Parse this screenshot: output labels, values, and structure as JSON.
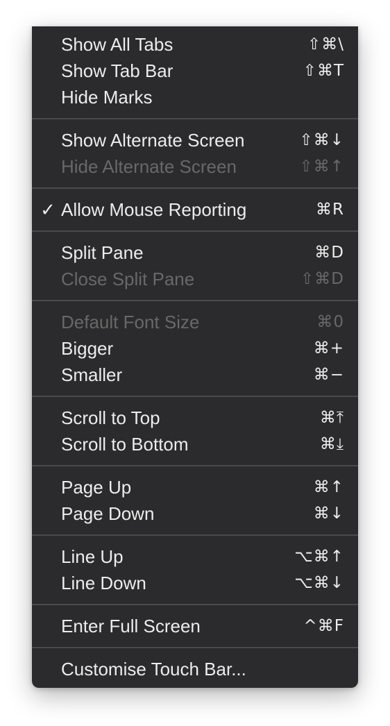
{
  "menu": {
    "groups": [
      [
        {
          "label": "Show All Tabs",
          "shortcut": "⇧⌘\\",
          "enabled": true,
          "checked": false
        },
        {
          "label": "Show Tab Bar",
          "shortcut": "⇧⌘T",
          "enabled": true,
          "checked": false
        },
        {
          "label": "Hide Marks",
          "shortcut": "",
          "enabled": true,
          "checked": false
        }
      ],
      [
        {
          "label": "Show Alternate Screen",
          "shortcut": "⇧⌘↓",
          "enabled": true,
          "checked": false
        },
        {
          "label": "Hide Alternate Screen",
          "shortcut": "⇧⌘↑",
          "enabled": false,
          "checked": false
        }
      ],
      [
        {
          "label": "Allow Mouse Reporting",
          "shortcut": "⌘R",
          "enabled": true,
          "checked": true
        }
      ],
      [
        {
          "label": "Split Pane",
          "shortcut": "⌘D",
          "enabled": true,
          "checked": false
        },
        {
          "label": "Close Split Pane",
          "shortcut": "⇧⌘D",
          "enabled": false,
          "checked": false
        }
      ],
      [
        {
          "label": "Default Font Size",
          "shortcut": "⌘0",
          "enabled": false,
          "checked": false
        },
        {
          "label": "Bigger",
          "shortcut": "⌘+",
          "enabled": true,
          "checked": false
        },
        {
          "label": "Smaller",
          "shortcut": "⌘−",
          "enabled": true,
          "checked": false
        }
      ],
      [
        {
          "label": "Scroll to Top",
          "shortcut": "⌘⤒",
          "enabled": true,
          "checked": false
        },
        {
          "label": "Scroll to Bottom",
          "shortcut": "⌘⤓",
          "enabled": true,
          "checked": false
        }
      ],
      [
        {
          "label": "Page Up",
          "shortcut": "⌘↑",
          "enabled": true,
          "checked": false
        },
        {
          "label": "Page Down",
          "shortcut": "⌘↓",
          "enabled": true,
          "checked": false
        }
      ],
      [
        {
          "label": "Line Up",
          "shortcut": "⌥⌘↑",
          "enabled": true,
          "checked": false
        },
        {
          "label": "Line Down",
          "shortcut": "⌥⌘↓",
          "enabled": true,
          "checked": false
        }
      ],
      [
        {
          "label": "Enter Full Screen",
          "shortcut": "^⌘F",
          "enabled": true,
          "checked": false
        }
      ],
      [
        {
          "label": "Customise Touch Bar...",
          "shortcut": "",
          "enabled": true,
          "checked": false
        }
      ]
    ],
    "check_glyph": "✓",
    "colors": {
      "background": "#2b2b2d",
      "text": "#ececec",
      "disabled_text": "#686868",
      "separator": "#4a4a4c"
    }
  }
}
